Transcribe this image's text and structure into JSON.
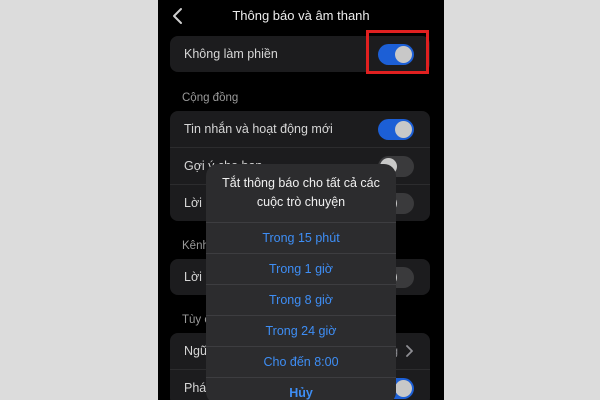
{
  "header": {
    "title": "Thông báo và âm thanh",
    "back_icon": "chevron-left-icon"
  },
  "dnd": {
    "label": "Không làm phiền",
    "toggle_on": true
  },
  "community": {
    "section_label": "Cộng đồng",
    "rows": [
      {
        "label": "Tin nhắn và hoạt động mới",
        "toggle_on": true
      },
      {
        "label": "Gợi ý cho bạn",
        "toggle_on": false
      },
      {
        "label": "Lời mời",
        "toggle_on": false
      }
    ]
  },
  "channels": {
    "section_label": "Kênh",
    "rows": [
      {
        "label": "Lời mời",
        "toggle_on": false
      }
    ]
  },
  "custom": {
    "section_label": "Tùy chỉnh",
    "rows": [
      {
        "label": "Ngữ",
        "value": "g",
        "chevron": true
      },
      {
        "label": "Phát",
        "toggle_on": true
      }
    ]
  },
  "sheet": {
    "title": "Tắt thông báo cho tất cả các cuộc trò chuyện",
    "options": [
      "Trong 15 phút",
      "Trong 1 giờ",
      "Trong 8 giờ",
      "Trong 24 giờ",
      "Cho đến 8:00"
    ],
    "cancel": "Hủy"
  },
  "colors": {
    "accent": "#3e8ef5",
    "toggle_on": "#1c5fd6",
    "highlight": "#e02020"
  }
}
